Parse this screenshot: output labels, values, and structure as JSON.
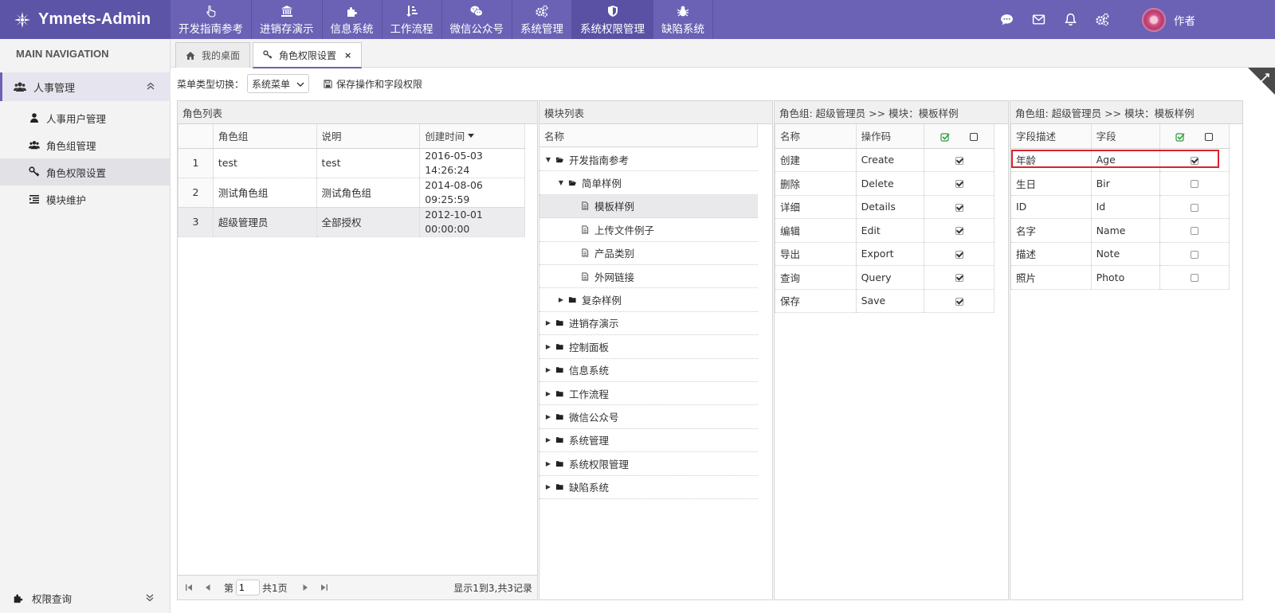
{
  "app": {
    "title": "Ymnets-Admin"
  },
  "topnav": [
    {
      "label": "开发指南参考",
      "icon": "hand-pointer-icon"
    },
    {
      "label": "进销存演示",
      "icon": "bank-icon"
    },
    {
      "label": "信息系统",
      "icon": "puzzle-icon"
    },
    {
      "label": "工作流程",
      "icon": "sort-amount-icon"
    },
    {
      "label": "微信公众号",
      "icon": "wechat-icon"
    },
    {
      "label": "系统管理",
      "icon": "gears-icon"
    },
    {
      "label": "系统权限管理",
      "icon": "shield-icon"
    },
    {
      "label": "缺陷系统",
      "icon": "bug-icon"
    }
  ],
  "topright": {
    "user_name": "作者",
    "icons": [
      "comment-icon",
      "envelope-icon",
      "bell-icon",
      "gears-icon"
    ]
  },
  "sidebar": {
    "header": "MAIN NAVIGATION",
    "group": "人事管理",
    "items": [
      {
        "label": "人事用户管理",
        "icon": "user-icon"
      },
      {
        "label": "角色组管理",
        "icon": "users-icon"
      },
      {
        "label": "角色权限设置",
        "icon": "key-icon"
      },
      {
        "label": "模块维护",
        "icon": "indent-icon"
      }
    ],
    "bottom": "权限查询"
  },
  "tabs": [
    {
      "label": "我的桌面",
      "icon": "home-icon"
    },
    {
      "label": "角色权限设置",
      "icon": "key-icon",
      "close": "×"
    }
  ],
  "toolbar": {
    "menu_type_label": "菜单类型切换：",
    "menu_type_value": "系统菜单",
    "save_label": "保存操作和字段权限"
  },
  "roles": {
    "title": "角色列表",
    "columns": [
      "角色组",
      "说明",
      "创建时间"
    ],
    "rows": [
      {
        "n": "1",
        "group": "test",
        "desc": "test",
        "date": "2016-05-03",
        "time": "14:26:24"
      },
      {
        "n": "2",
        "group": "测试角色组",
        "desc": "测试角色组",
        "date": "2014-08-06",
        "time": "09:25:59"
      },
      {
        "n": "3",
        "group": "超级管理员",
        "desc": "全部授权",
        "date": "2012-10-01",
        "time": "00:00:00"
      }
    ],
    "pager": {
      "page_prefix": "第",
      "page_value": "1",
      "page_suffix": "共1页",
      "summary": "显示1到3,共3记录"
    }
  },
  "modules": {
    "title": "模块列表",
    "column": "名称",
    "items": [
      "开发指南参考",
      "简单样例",
      "模板样例",
      "上传文件例子",
      "产品类别",
      "外网链接",
      "复杂样例",
      "进销存演示",
      "控制面板",
      "信息系统",
      "工作流程",
      "微信公众号",
      "系统管理",
      "系统权限管理",
      "缺陷系统"
    ]
  },
  "operations": {
    "title": "角色组: 超级管理员 >> 模块：模板样例",
    "columns": [
      "名称",
      "操作码"
    ],
    "rows": [
      {
        "name": "创建",
        "code": "Create",
        "checked": true
      },
      {
        "name": "删除",
        "code": "Delete",
        "checked": true
      },
      {
        "name": "详细",
        "code": "Details",
        "checked": true
      },
      {
        "name": "编辑",
        "code": "Edit",
        "checked": true
      },
      {
        "name": "导出",
        "code": "Export",
        "checked": true
      },
      {
        "name": "查询",
        "code": "Query",
        "checked": true
      },
      {
        "name": "保存",
        "code": "Save",
        "checked": true
      }
    ]
  },
  "fields": {
    "title": "角色组: 超级管理员 >> 模块：模板样例",
    "columns": [
      "字段描述",
      "字段"
    ],
    "rows": [
      {
        "desc": "年龄",
        "field": "Age",
        "checked": true
      },
      {
        "desc": "生日",
        "field": "Bir",
        "checked": false
      },
      {
        "desc": "ID",
        "field": "Id",
        "checked": false
      },
      {
        "desc": "名字",
        "field": "Name",
        "checked": false
      },
      {
        "desc": "描述",
        "field": "Note",
        "checked": false
      },
      {
        "desc": "照片",
        "field": "Photo",
        "checked": false
      }
    ]
  },
  "colors": {
    "brand": "#6b62b5",
    "brand_dark": "#5c54a6",
    "highlight_box": "#d9232e",
    "check_green": "#2e9e3a"
  }
}
